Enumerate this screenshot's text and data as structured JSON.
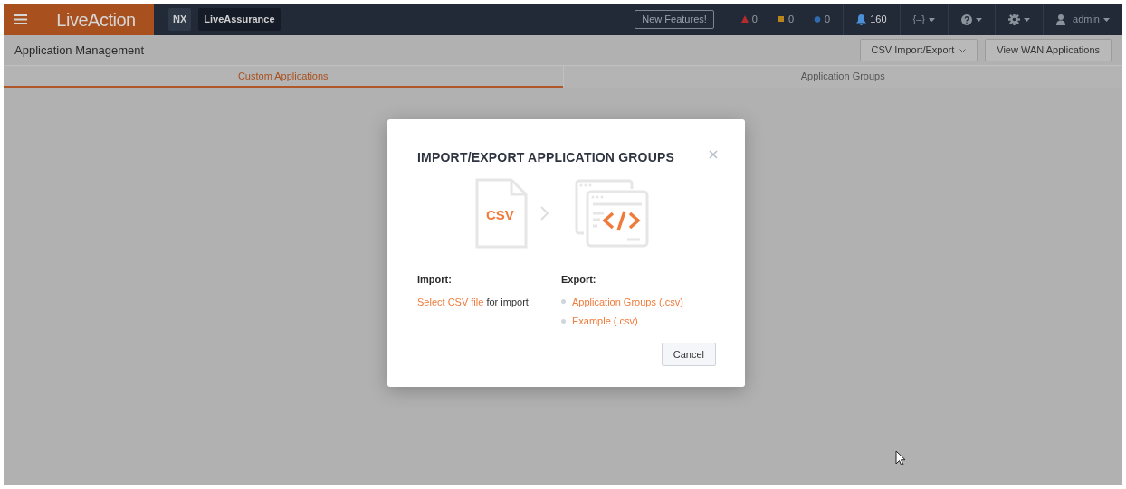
{
  "header": {
    "brand": "LiveAction",
    "badges": [
      {
        "label": "NX",
        "kind": "product"
      },
      {
        "label": "LiveAssurance",
        "kind": "app"
      }
    ],
    "new_features": "New Features!",
    "alerts": [
      {
        "kind": "triangle",
        "color": "#b52a2a",
        "count": "0"
      },
      {
        "kind": "square",
        "color": "#b8861c",
        "count": "0"
      },
      {
        "kind": "circle",
        "color": "#2f6bb0",
        "count": "0"
      }
    ],
    "notifications": "160",
    "menus": [
      {
        "kind": "text",
        "label": "{–}"
      },
      {
        "kind": "help"
      },
      {
        "kind": "gear"
      },
      {
        "kind": "user",
        "label": "admin"
      }
    ]
  },
  "page": {
    "title": "Application Management",
    "buttons": [
      {
        "label": "CSV Import/Export",
        "dropdown": true
      },
      {
        "label": "View WAN Applications",
        "dropdown": false
      }
    ]
  },
  "tabs": [
    {
      "label": "Custom Applications",
      "selected": true
    },
    {
      "label": "Application Groups",
      "selected": false
    }
  ],
  "modal": {
    "title": "IMPORT/EXPORT APPLICATION GROUPS",
    "file_label": "CSV",
    "import": {
      "heading": "Import:",
      "link": "Select CSV file",
      "text": "for import"
    },
    "export": {
      "heading": "Export:",
      "links": [
        "Application Groups (.csv)",
        "Example (.csv)"
      ]
    },
    "cancel": "Cancel"
  }
}
